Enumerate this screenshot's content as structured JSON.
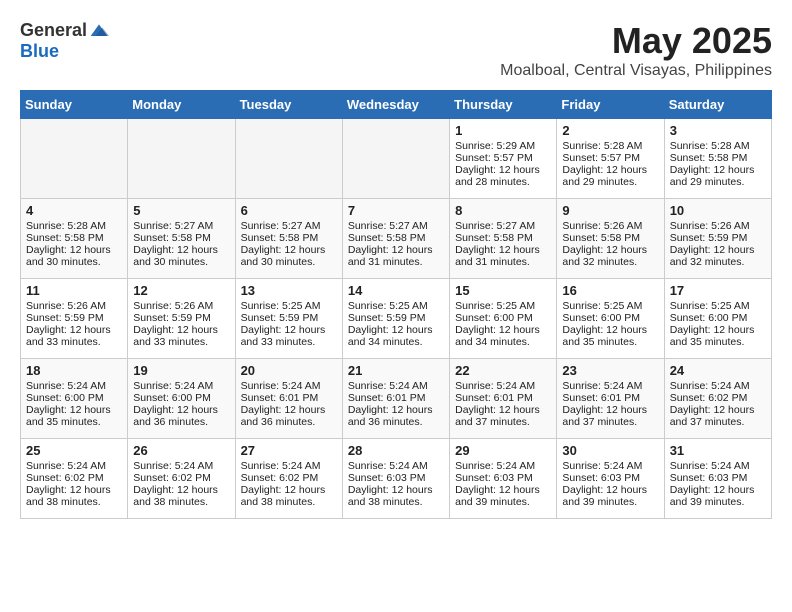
{
  "logo": {
    "general": "General",
    "blue": "Blue"
  },
  "title": "May 2025",
  "location": "Moalboal, Central Visayas, Philippines",
  "headers": [
    "Sunday",
    "Monday",
    "Tuesday",
    "Wednesday",
    "Thursday",
    "Friday",
    "Saturday"
  ],
  "weeks": [
    [
      {
        "day": "",
        "content": ""
      },
      {
        "day": "",
        "content": ""
      },
      {
        "day": "",
        "content": ""
      },
      {
        "day": "",
        "content": ""
      },
      {
        "day": "1",
        "content": "Sunrise: 5:29 AM\nSunset: 5:57 PM\nDaylight: 12 hours and 28 minutes."
      },
      {
        "day": "2",
        "content": "Sunrise: 5:28 AM\nSunset: 5:57 PM\nDaylight: 12 hours and 29 minutes."
      },
      {
        "day": "3",
        "content": "Sunrise: 5:28 AM\nSunset: 5:58 PM\nDaylight: 12 hours and 29 minutes."
      }
    ],
    [
      {
        "day": "4",
        "content": "Sunrise: 5:28 AM\nSunset: 5:58 PM\nDaylight: 12 hours and 30 minutes."
      },
      {
        "day": "5",
        "content": "Sunrise: 5:27 AM\nSunset: 5:58 PM\nDaylight: 12 hours and 30 minutes."
      },
      {
        "day": "6",
        "content": "Sunrise: 5:27 AM\nSunset: 5:58 PM\nDaylight: 12 hours and 30 minutes."
      },
      {
        "day": "7",
        "content": "Sunrise: 5:27 AM\nSunset: 5:58 PM\nDaylight: 12 hours and 31 minutes."
      },
      {
        "day": "8",
        "content": "Sunrise: 5:27 AM\nSunset: 5:58 PM\nDaylight: 12 hours and 31 minutes."
      },
      {
        "day": "9",
        "content": "Sunrise: 5:26 AM\nSunset: 5:58 PM\nDaylight: 12 hours and 32 minutes."
      },
      {
        "day": "10",
        "content": "Sunrise: 5:26 AM\nSunset: 5:59 PM\nDaylight: 12 hours and 32 minutes."
      }
    ],
    [
      {
        "day": "11",
        "content": "Sunrise: 5:26 AM\nSunset: 5:59 PM\nDaylight: 12 hours and 33 minutes."
      },
      {
        "day": "12",
        "content": "Sunrise: 5:26 AM\nSunset: 5:59 PM\nDaylight: 12 hours and 33 minutes."
      },
      {
        "day": "13",
        "content": "Sunrise: 5:25 AM\nSunset: 5:59 PM\nDaylight: 12 hours and 33 minutes."
      },
      {
        "day": "14",
        "content": "Sunrise: 5:25 AM\nSunset: 5:59 PM\nDaylight: 12 hours and 34 minutes."
      },
      {
        "day": "15",
        "content": "Sunrise: 5:25 AM\nSunset: 6:00 PM\nDaylight: 12 hours and 34 minutes."
      },
      {
        "day": "16",
        "content": "Sunrise: 5:25 AM\nSunset: 6:00 PM\nDaylight: 12 hours and 35 minutes."
      },
      {
        "day": "17",
        "content": "Sunrise: 5:25 AM\nSunset: 6:00 PM\nDaylight: 12 hours and 35 minutes."
      }
    ],
    [
      {
        "day": "18",
        "content": "Sunrise: 5:24 AM\nSunset: 6:00 PM\nDaylight: 12 hours and 35 minutes."
      },
      {
        "day": "19",
        "content": "Sunrise: 5:24 AM\nSunset: 6:00 PM\nDaylight: 12 hours and 36 minutes."
      },
      {
        "day": "20",
        "content": "Sunrise: 5:24 AM\nSunset: 6:01 PM\nDaylight: 12 hours and 36 minutes."
      },
      {
        "day": "21",
        "content": "Sunrise: 5:24 AM\nSunset: 6:01 PM\nDaylight: 12 hours and 36 minutes."
      },
      {
        "day": "22",
        "content": "Sunrise: 5:24 AM\nSunset: 6:01 PM\nDaylight: 12 hours and 37 minutes."
      },
      {
        "day": "23",
        "content": "Sunrise: 5:24 AM\nSunset: 6:01 PM\nDaylight: 12 hours and 37 minutes."
      },
      {
        "day": "24",
        "content": "Sunrise: 5:24 AM\nSunset: 6:02 PM\nDaylight: 12 hours and 37 minutes."
      }
    ],
    [
      {
        "day": "25",
        "content": "Sunrise: 5:24 AM\nSunset: 6:02 PM\nDaylight: 12 hours and 38 minutes."
      },
      {
        "day": "26",
        "content": "Sunrise: 5:24 AM\nSunset: 6:02 PM\nDaylight: 12 hours and 38 minutes."
      },
      {
        "day": "27",
        "content": "Sunrise: 5:24 AM\nSunset: 6:02 PM\nDaylight: 12 hours and 38 minutes."
      },
      {
        "day": "28",
        "content": "Sunrise: 5:24 AM\nSunset: 6:03 PM\nDaylight: 12 hours and 38 minutes."
      },
      {
        "day": "29",
        "content": "Sunrise: 5:24 AM\nSunset: 6:03 PM\nDaylight: 12 hours and 39 minutes."
      },
      {
        "day": "30",
        "content": "Sunrise: 5:24 AM\nSunset: 6:03 PM\nDaylight: 12 hours and 39 minutes."
      },
      {
        "day": "31",
        "content": "Sunrise: 5:24 AM\nSunset: 6:03 PM\nDaylight: 12 hours and 39 minutes."
      }
    ]
  ]
}
